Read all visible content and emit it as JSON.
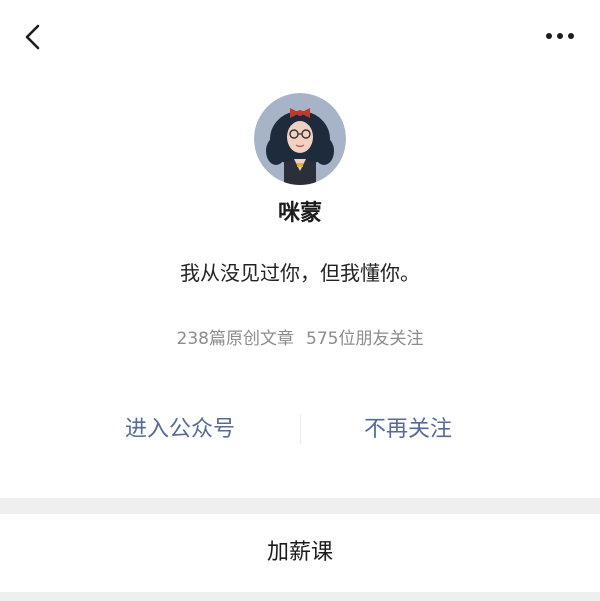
{
  "nav": {
    "back_icon": "chevron-left-icon",
    "more_icon": "more-dots-icon"
  },
  "profile": {
    "name": "咪蒙",
    "bio": "我从没见过你，但我懂你。",
    "articles": "238篇原创文章",
    "followers": "575位朋友关注"
  },
  "actions": {
    "enter": "进入公众号",
    "unfollow": "不再关注"
  },
  "menu": {
    "item_label": "加薪课"
  },
  "colors": {
    "link": "#576b95",
    "muted": "#8c8c8c",
    "band": "#efefef"
  }
}
